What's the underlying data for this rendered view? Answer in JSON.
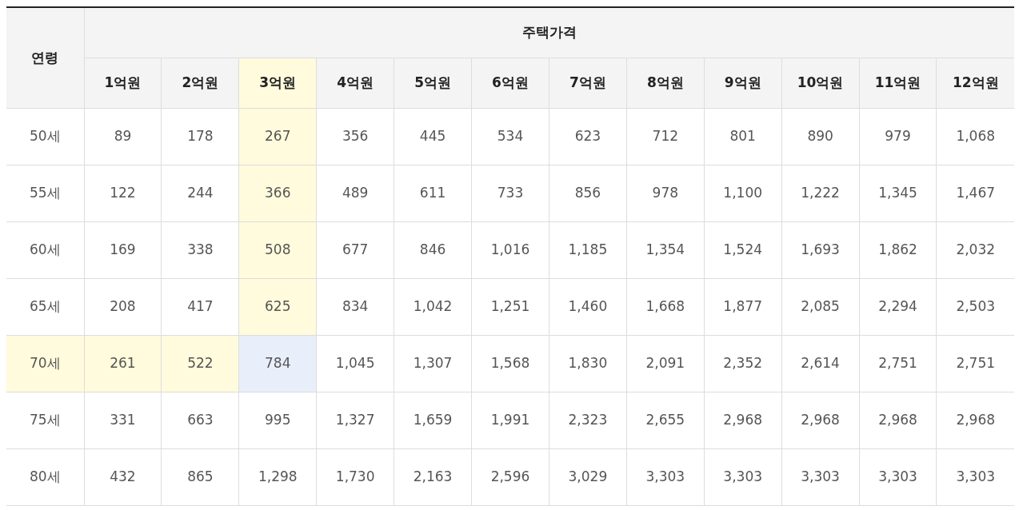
{
  "table": {
    "age_header": "연령",
    "price_header": "주택가격",
    "columns": [
      {
        "label": "1억원",
        "selected": false
      },
      {
        "label": "2억원",
        "selected": false
      },
      {
        "label": "3억원",
        "selected": true
      },
      {
        "label": "4억원",
        "selected": false
      },
      {
        "label": "5억원",
        "selected": false
      },
      {
        "label": "6억원",
        "selected": false
      },
      {
        "label": "7억원",
        "selected": false
      },
      {
        "label": "8억원",
        "selected": false
      },
      {
        "label": "9억원",
        "selected": false
      },
      {
        "label": "10억원",
        "selected": false
      },
      {
        "label": "11억원",
        "selected": false
      },
      {
        "label": "12억원",
        "selected": false
      }
    ],
    "rows": [
      {
        "age": "50세",
        "selected": false,
        "values": [
          "89",
          "178",
          "267",
          "356",
          "445",
          "534",
          "623",
          "712",
          "801",
          "890",
          "979",
          "1,068"
        ]
      },
      {
        "age": "55세",
        "selected": false,
        "values": [
          "122",
          "244",
          "366",
          "489",
          "611",
          "733",
          "856",
          "978",
          "1,100",
          "1,222",
          "1,345",
          "1,467"
        ]
      },
      {
        "age": "60세",
        "selected": false,
        "values": [
          "169",
          "338",
          "508",
          "677",
          "846",
          "1,016",
          "1,185",
          "1,354",
          "1,524",
          "1,693",
          "1,862",
          "2,032"
        ]
      },
      {
        "age": "65세",
        "selected": false,
        "values": [
          "208",
          "417",
          "625",
          "834",
          "1,042",
          "1,251",
          "1,460",
          "1,668",
          "1,877",
          "2,085",
          "2,294",
          "2,503"
        ]
      },
      {
        "age": "70세",
        "selected": true,
        "values": [
          "261",
          "522",
          "784",
          "1,045",
          "1,307",
          "1,568",
          "1,830",
          "2,091",
          "2,352",
          "2,614",
          "2,751",
          "2,751"
        ]
      },
      {
        "age": "75세",
        "selected": false,
        "values": [
          "331",
          "663",
          "995",
          "1,327",
          "1,659",
          "1,991",
          "2,323",
          "2,655",
          "2,968",
          "2,968",
          "2,968",
          "2,968"
        ]
      },
      {
        "age": "80세",
        "selected": false,
        "values": [
          "432",
          "865",
          "1,298",
          "1,730",
          "2,163",
          "2,596",
          "3,029",
          "3,303",
          "3,303",
          "3,303",
          "3,303",
          "3,303"
        ]
      }
    ]
  }
}
